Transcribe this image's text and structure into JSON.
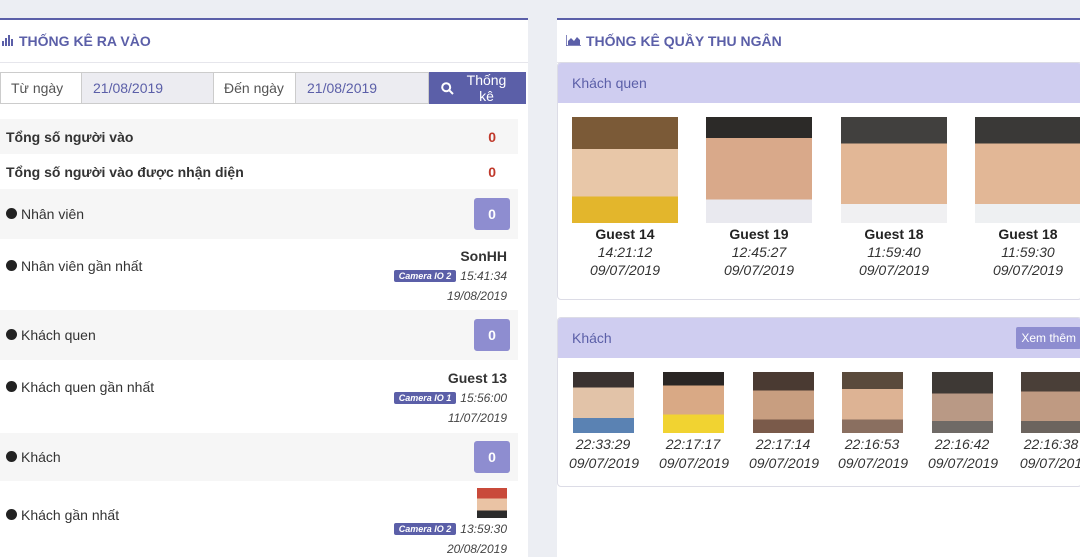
{
  "left": {
    "title": "THỐNG KÊ RA VÀO",
    "filter": {
      "from_label": "Từ ngày",
      "from_value": "21/08/2019",
      "to_label": "Đến ngày",
      "to_value": "21/08/2019",
      "button_label": "Thống kê"
    },
    "total_in": {
      "label": "Tổng số người vào",
      "value": "0"
    },
    "total_recognized": {
      "label": "Tổng số người vào được nhận diện",
      "value": "0"
    },
    "staff": {
      "label": "Nhân viên",
      "value": "0"
    },
    "staff_recent": {
      "label": "Nhân viên gần nhất",
      "name": "SonHH",
      "camera": "Camera IO 2",
      "time": "15:41:34",
      "date": "19/08/2019"
    },
    "regular": {
      "label": "Khách quen",
      "value": "0"
    },
    "regular_recent": {
      "label": "Khách quen gần nhất",
      "name": "Guest 13",
      "camera": "Camera IO 1",
      "time": "15:56:00",
      "date": "11/07/2019"
    },
    "guest": {
      "label": "Khách",
      "value": "0"
    },
    "guest_recent": {
      "label": "Khách gần nhất",
      "camera": "Camera IO 2",
      "time": "13:59:30",
      "date": "20/08/2019"
    }
  },
  "right": {
    "title": "THỐNG KÊ QUẦY THU NGÂN",
    "regulars": {
      "header": "Khách quen",
      "items": [
        {
          "name": "Guest 14",
          "time": "14:21:12",
          "date": "09/07/2019"
        },
        {
          "name": "Guest 19",
          "time": "12:45:27",
          "date": "09/07/2019"
        },
        {
          "name": "Guest 18",
          "time": "11:59:40",
          "date": "09/07/2019"
        },
        {
          "name": "Guest 18",
          "time": "11:59:30",
          "date": "09/07/2019"
        }
      ]
    },
    "guests": {
      "header": "Khách",
      "more_label": "Xem thêm",
      "items": [
        {
          "time": "22:33:29",
          "date": "09/07/2019"
        },
        {
          "time": "22:17:17",
          "date": "09/07/2019"
        },
        {
          "time": "22:17:14",
          "date": "09/07/2019"
        },
        {
          "time": "22:16:53",
          "date": "09/07/2019"
        },
        {
          "time": "22:16:42",
          "date": "09/07/2019"
        },
        {
          "time": "22:16:38",
          "date": "09/07/201"
        }
      ]
    }
  },
  "colors": {
    "accent": "#5b5fa8",
    "count_box": "#8e8dd0",
    "card_header": "#cfcdf0",
    "red_value": "#c0392b"
  }
}
